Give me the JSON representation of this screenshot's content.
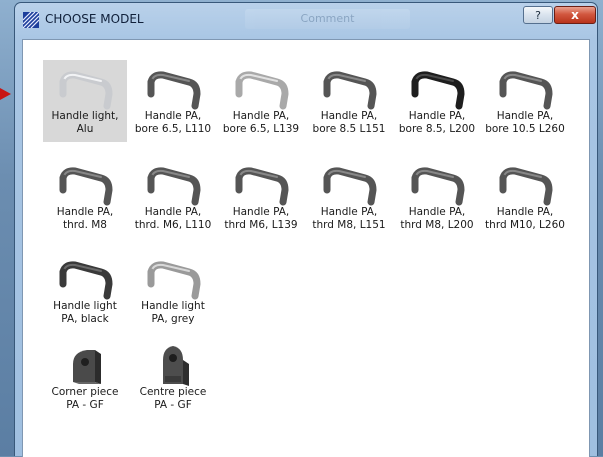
{
  "window": {
    "title": "CHOOSE MODEL",
    "help_label": "?",
    "close_label": "x",
    "background_tab_label": "Comment"
  },
  "colors": {
    "selected_bg": "#d8d8d8",
    "close_red": "#c8452a",
    "pointer_red": "#c81414"
  },
  "models": [
    {
      "label": "Handle light,\nAlu",
      "icon": "handle-light-alu-icon",
      "selected": true
    },
    {
      "label": "Handle PA,\nbore 6.5, L110",
      "icon": "handle-pa-icon"
    },
    {
      "label": "Handle PA,\nbore 6.5, L139",
      "icon": "handle-pa-icon"
    },
    {
      "label": "Handle PA,\nbore 8.5 L151",
      "icon": "handle-pa-icon"
    },
    {
      "label": "Handle PA,\nbore 8.5, L200",
      "icon": "handle-pa-icon"
    },
    {
      "label": "Handle PA,\nbore 10.5 L260",
      "icon": "handle-pa-icon"
    },
    {
      "label": "Handle PA,\nthrd. M8",
      "icon": "handle-pa-icon"
    },
    {
      "label": "Handle PA,\nthrd. M6, L110",
      "icon": "handle-pa-icon"
    },
    {
      "label": "Handle PA,\nthrd M6, L139",
      "icon": "handle-pa-icon"
    },
    {
      "label": "Handle PA,\nthrd M8, L151",
      "icon": "handle-pa-icon"
    },
    {
      "label": "Handle PA,\nthrd M8, L200",
      "icon": "handle-pa-icon"
    },
    {
      "label": "Handle PA,\nthrd M10, L260",
      "icon": "handle-pa-icon"
    },
    {
      "label": "Handle light\nPA, black",
      "icon": "handle-light-black-icon"
    },
    {
      "label": "Handle light\nPA, grey",
      "icon": "handle-light-grey-icon"
    },
    {
      "label": "Corner piece\nPA - GF",
      "icon": "corner-piece-icon"
    },
    {
      "label": "Centre piece\nPA - GF",
      "icon": "centre-piece-icon"
    }
  ]
}
